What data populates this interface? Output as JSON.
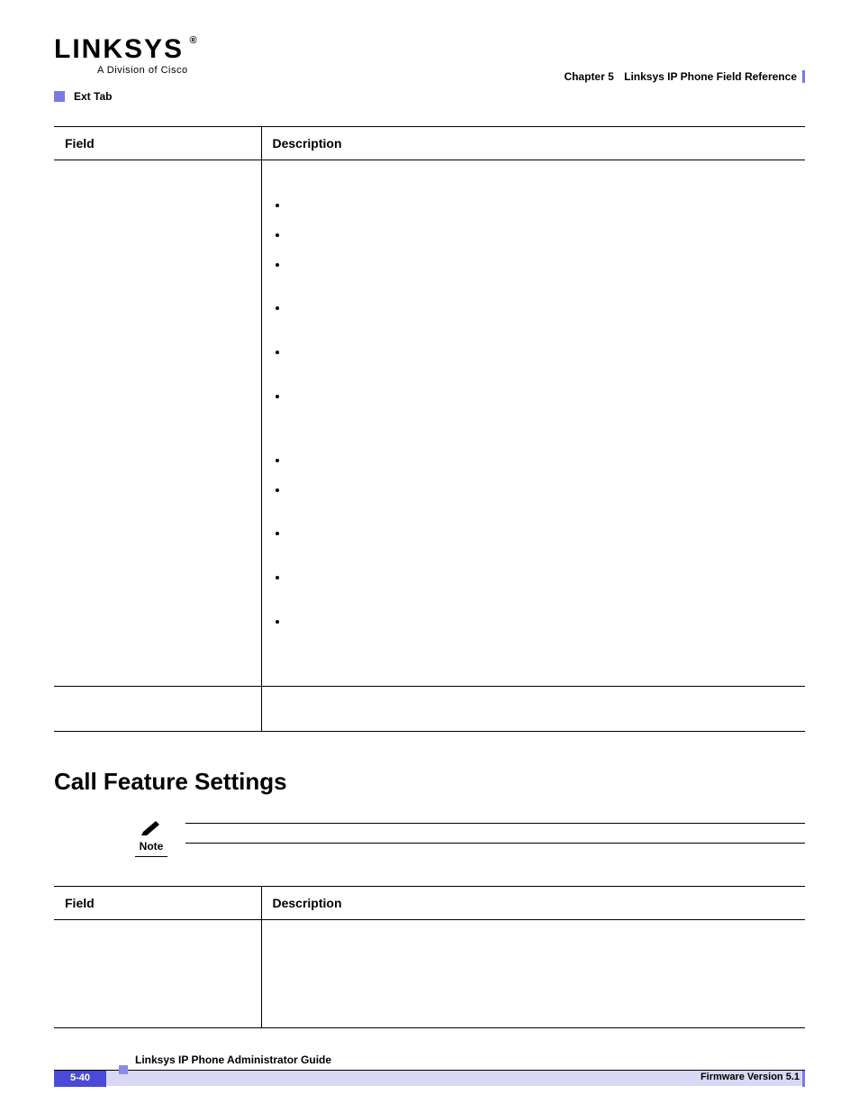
{
  "header": {
    "logo_main": "LINKSYS",
    "logo_sub": "A Division of Cisco",
    "chapter": "Chapter 5",
    "chapter_title": "Linksys IP Phone Field Reference",
    "tab_label": "Ext Tab"
  },
  "table1": {
    "col_field": "Field",
    "col_desc": "Description"
  },
  "section": {
    "heading": "Call Feature Settings",
    "note_label": "Note"
  },
  "table2": {
    "col_field": "Field",
    "col_desc": "Description"
  },
  "footer": {
    "guide_title": "Linksys IP Phone Administrator Guide",
    "page_num": "5-40",
    "firmware": "Firmware Version 5.1"
  }
}
